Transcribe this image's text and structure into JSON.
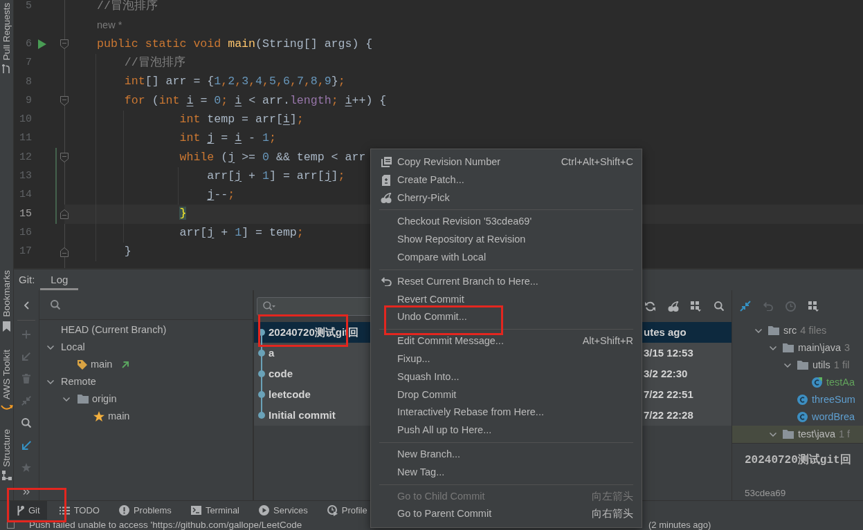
{
  "left_stripe": {
    "top": [
      {
        "label": "Pull Requests"
      }
    ],
    "bottom": [
      {
        "label": "Bookmarks"
      },
      {
        "label": "AWS Toolkit"
      },
      {
        "label": "Structure"
      }
    ]
  },
  "editor": {
    "lines": [
      {
        "kind": "code",
        "number": "5",
        "current": false,
        "changed": false,
        "runnable": false,
        "tokens": [
          {
            "kind": "comment",
            "text": "//冒泡排序"
          }
        ]
      },
      {
        "kind": "hint",
        "text": "new *"
      },
      {
        "kind": "block_start",
        "number": "6",
        "current": false,
        "changed": false,
        "runnable": true,
        "tokens": [
          {
            "kind": "keyword",
            "text": "public static void "
          },
          {
            "kind": "method",
            "text": "main"
          },
          {
            "kind": "plain",
            "text": "(String[] args) {"
          }
        ]
      },
      {
        "kind": "code",
        "number": "7",
        "current": false,
        "changed": false,
        "runnable": false,
        "tokens": [
          {
            "kind": "comment",
            "text": "    //冒泡排序"
          }
        ]
      },
      {
        "kind": "code",
        "number": "8",
        "current": false,
        "changed": false,
        "runnable": false,
        "tokens": [
          {
            "kind": "keyword",
            "text": "    int"
          },
          {
            "kind": "plain",
            "text": "[] arr = {"
          },
          {
            "kind": "number",
            "text": "1"
          },
          {
            "kind": "punct",
            "text": ","
          },
          {
            "kind": "number",
            "text": "2"
          },
          {
            "kind": "punct",
            "text": ","
          },
          {
            "kind": "number",
            "text": "3"
          },
          {
            "kind": "punct",
            "text": ","
          },
          {
            "kind": "number",
            "text": "4"
          },
          {
            "kind": "punct",
            "text": ","
          },
          {
            "kind": "number",
            "text": "5"
          },
          {
            "kind": "punct",
            "text": ","
          },
          {
            "kind": "number",
            "text": "6"
          },
          {
            "kind": "punct",
            "text": ","
          },
          {
            "kind": "number",
            "text": "7"
          },
          {
            "kind": "punct",
            "text": ","
          },
          {
            "kind": "number",
            "text": "8"
          },
          {
            "kind": "punct",
            "text": ","
          },
          {
            "kind": "number",
            "text": "9"
          },
          {
            "kind": "plain",
            "text": "}"
          },
          {
            "kind": "punct",
            "text": ";"
          }
        ]
      },
      {
        "kind": "block_start",
        "number": "9",
        "current": false,
        "changed": false,
        "runnable": false,
        "tokens": [
          {
            "kind": "keyword",
            "text": "    for"
          },
          {
            "kind": "plain",
            "text": " ("
          },
          {
            "kind": "keyword",
            "text": "int "
          },
          {
            "kind": "variable",
            "text": "i"
          },
          {
            "kind": "plain",
            "text": " = "
          },
          {
            "kind": "number",
            "text": "0"
          },
          {
            "kind": "punct",
            "text": "; "
          },
          {
            "kind": "variable",
            "text": "i"
          },
          {
            "kind": "plain",
            "text": " < arr."
          },
          {
            "kind": "field",
            "text": "length"
          },
          {
            "kind": "punct",
            "text": "; "
          },
          {
            "kind": "variable",
            "text": "i"
          },
          {
            "kind": "plain",
            "text": "++) {"
          }
        ]
      },
      {
        "kind": "code",
        "number": "10",
        "current": false,
        "changed": false,
        "runnable": false,
        "tokens": [
          {
            "kind": "keyword",
            "text": "            int"
          },
          {
            "kind": "plain",
            "text": " temp = arr["
          },
          {
            "kind": "variable",
            "text": "i"
          },
          {
            "kind": "plain",
            "text": "]"
          },
          {
            "kind": "punct",
            "text": ";"
          }
        ]
      },
      {
        "kind": "code",
        "number": "11",
        "current": false,
        "changed": false,
        "runnable": false,
        "tokens": [
          {
            "kind": "keyword",
            "text": "            int "
          },
          {
            "kind": "variable",
            "text": "j"
          },
          {
            "kind": "plain",
            "text": " = "
          },
          {
            "kind": "variable",
            "text": "i"
          },
          {
            "kind": "plain",
            "text": " - "
          },
          {
            "kind": "number",
            "text": "1"
          },
          {
            "kind": "punct",
            "text": ";"
          }
        ]
      },
      {
        "kind": "block_start",
        "number": "12",
        "current": false,
        "changed": true,
        "runnable": false,
        "tokens": [
          {
            "kind": "keyword",
            "text": "            while"
          },
          {
            "kind": "plain",
            "text": " ("
          },
          {
            "kind": "variable",
            "text": "j"
          },
          {
            "kind": "plain",
            "text": " >= "
          },
          {
            "kind": "number",
            "text": "0"
          },
          {
            "kind": "plain",
            "text": " && temp < arr"
          }
        ]
      },
      {
        "kind": "code",
        "number": "13",
        "current": false,
        "changed": true,
        "runnable": false,
        "tokens": [
          {
            "kind": "plain",
            "text": "                arr["
          },
          {
            "kind": "variable",
            "text": "j"
          },
          {
            "kind": "plain",
            "text": " + "
          },
          {
            "kind": "number",
            "text": "1"
          },
          {
            "kind": "plain",
            "text": "] = arr["
          },
          {
            "kind": "variable",
            "text": "j"
          },
          {
            "kind": "plain",
            "text": "]"
          },
          {
            "kind": "punct",
            "text": ";"
          }
        ]
      },
      {
        "kind": "code",
        "number": "14",
        "current": false,
        "changed": true,
        "runnable": false,
        "tokens": [
          {
            "kind": "variable",
            "text": "                j"
          },
          {
            "kind": "plain",
            "text": "--"
          },
          {
            "kind": "punct",
            "text": ";"
          }
        ]
      },
      {
        "kind": "block_end",
        "number": "15",
        "current": true,
        "changed": true,
        "runnable": false,
        "tokens": [
          {
            "kind": "brace_match",
            "text": "            }"
          }
        ]
      },
      {
        "kind": "code",
        "number": "16",
        "current": false,
        "changed": false,
        "runnable": false,
        "tokens": [
          {
            "kind": "plain",
            "text": "            arr["
          },
          {
            "kind": "variable",
            "text": "j"
          },
          {
            "kind": "plain",
            "text": " + "
          },
          {
            "kind": "number",
            "text": "1"
          },
          {
            "kind": "plain",
            "text": "] = temp"
          },
          {
            "kind": "punct",
            "text": ";"
          }
        ]
      },
      {
        "kind": "block_end",
        "number": "17",
        "current": false,
        "changed": false,
        "runnable": false,
        "tokens": [
          {
            "kind": "plain",
            "text": "    }"
          }
        ]
      }
    ]
  },
  "git_window": {
    "title": "Git:",
    "tabs": [
      {
        "label": "Log",
        "selected": true
      }
    ],
    "branch_toolbar": [
      {
        "disabled": false
      },
      {
        "disabled": true
      },
      {
        "disabled": true
      },
      {
        "disabled": true
      },
      {
        "disabled": true
      },
      {
        "disabled": false
      },
      {
        "disabled": false
      },
      {
        "disabled": true
      }
    ],
    "branches": [
      {
        "label": "HEAD (Current Branch)"
      },
      {
        "label": "Local",
        "expanded": true,
        "children": [
          {
            "kind": "local_branch",
            "label": "main",
            "outgoing": true
          }
        ]
      },
      {
        "label": "Remote",
        "expanded": true,
        "children": [
          {
            "kind": "remote",
            "label": "origin",
            "expanded": true,
            "children": [
              {
                "kind": "favorite_branch",
                "label": "main",
                "outgoing": false
              }
            ]
          }
        ]
      }
    ],
    "log": {
      "commits": [
        {
          "message": "20240720测试git回",
          "date": "utes ago",
          "selected": true,
          "annotated": true
        },
        {
          "message": "a",
          "date": "3/15 12:53",
          "selected": false
        },
        {
          "message": "code",
          "date": "3/2 22:30",
          "selected": false
        },
        {
          "message": "leetcode",
          "date": "7/22 22:51",
          "selected": false
        },
        {
          "message": "Initial commit",
          "date": "7/22 22:28",
          "selected": false
        }
      ]
    },
    "changes": {
      "toolbar": [
        {
          "disabled": false
        },
        {
          "disabled": true
        },
        {
          "disabled": true
        },
        {
          "disabled": false
        }
      ],
      "tree": [
        {
          "kind": "folder",
          "label": "src",
          "count": "4 files",
          "expanded": true,
          "selected": false,
          "children": [
            {
              "kind": "folder",
              "label": "main\\java",
              "count": "3",
              "expanded": true,
              "selected": false,
              "children": [
                {
                  "kind": "folder",
                  "label": "utils",
                  "count": "1 fil",
                  "expanded": true,
                  "selected": false,
                  "children": [
                    {
                      "kind": "runnable_class",
                      "label": "testAa",
                      "color": "#62a35c",
                      "selected": false
                    }
                  ]
                },
                {
                  "kind": "class",
                  "label": "threeSum",
                  "color": "#5f9fd0",
                  "selected": false
                },
                {
                  "kind": "class",
                  "label": "wordBrea",
                  "color": "#5f9fd0",
                  "selected": false
                }
              ]
            },
            {
              "kind": "folder",
              "label": "test\\java",
              "count": "1 f",
              "expanded": true,
              "selected": true
            }
          ]
        }
      ],
      "details": {
        "subject": "20240720测试git回",
        "hash": "53cdea69"
      }
    }
  },
  "context_menu": {
    "groups": [
      [
        {
          "label": "Copy Revision Number",
          "shortcut": "Ctrl+Alt+Shift+C",
          "disabled": false
        },
        {
          "label": "Create Patch...",
          "disabled": false
        },
        {
          "label": "Cherry-Pick",
          "disabled": false
        }
      ],
      [
        {
          "label": "Checkout Revision '53cdea69'",
          "disabled": false
        },
        {
          "label": "Show Repository at Revision",
          "disabled": false
        },
        {
          "label": "Compare with Local",
          "disabled": false
        }
      ],
      [
        {
          "label": "Reset Current Branch to Here...",
          "disabled": false
        },
        {
          "label": "Revert Commit",
          "disabled": false
        },
        {
          "label": "Undo Commit...",
          "disabled": false,
          "annotated": true
        }
      ],
      [
        {
          "label": "Edit Commit Message...",
          "shortcut": "Alt+Shift+R",
          "disabled": false
        },
        {
          "label": "Fixup...",
          "disabled": false
        },
        {
          "label": "Squash Into...",
          "disabled": false
        },
        {
          "label": "Drop Commit",
          "disabled": false
        },
        {
          "label": "Interactively Rebase from Here...",
          "disabled": false
        },
        {
          "label": "Push All up to Here...",
          "disabled": false
        }
      ],
      [
        {
          "label": "New Branch...",
          "disabled": false
        },
        {
          "label": "New Tag...",
          "disabled": false
        }
      ],
      [
        {
          "label": "Go to Child Commit",
          "shortcut": "向左箭头",
          "disabled": true
        },
        {
          "label": "Go to Parent Commit",
          "shortcut": "向右箭头",
          "disabled": false
        }
      ]
    ]
  },
  "tool_tabs": [
    {
      "label": "Git",
      "selected": true,
      "annotated": true
    },
    {
      "label": "TODO",
      "selected": false
    },
    {
      "label": "Problems",
      "selected": false
    },
    {
      "label": "Terminal",
      "selected": false
    },
    {
      "label": "Services",
      "selected": false
    },
    {
      "label": "Profile",
      "selected": false
    }
  ],
  "status_bar": {
    "message": "Push failed unable to access 'https://github.com/gallope/LeetCode",
    "time": "(2 minutes ago)"
  }
}
